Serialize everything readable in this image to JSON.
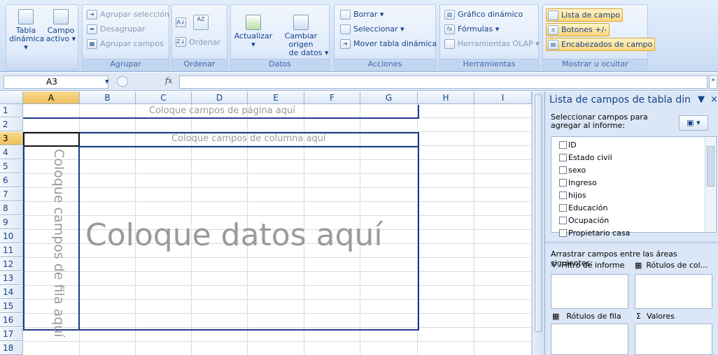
{
  "ribbon": {
    "groups": {
      "tabla_dinamica": {
        "btn_tabla": "Tabla",
        "btn_tabla2": "dinámica ▾",
        "btn_campo": "Campo",
        "btn_campo2": "activo ▾"
      },
      "agrupar": {
        "caption": "Agrupar",
        "agrupar_sel": "Agrupar selección",
        "desagrupar": "Desagrupar",
        "agrupar_campos": "Agrupar campos"
      },
      "ordenar": {
        "caption": "Ordenar",
        "ordenar": "Ordenar"
      },
      "datos": {
        "caption": "Datos",
        "actualizar": "Actualizar",
        "cambiar_origen": "Cambiar origen",
        "de_datos": "de datos ▾"
      },
      "acciones": {
        "caption": "Acciones",
        "borrar": "Borrar ▾",
        "seleccionar": "Seleccionar ▾",
        "mover": "Mover tabla dinámica"
      },
      "herramientas": {
        "caption": "Herramientas",
        "grafico": "Gráfico dinámico",
        "formulas": "Fórmulas ▾",
        "olap": "Herramientas OLAP ▾"
      },
      "mostrar": {
        "caption": "Mostrar u ocultar",
        "lista": "Lista de campo",
        "botones": "Botones +/-",
        "encabezados": "Encabezados de campo"
      }
    }
  },
  "formula_bar": {
    "name_box": "A3",
    "fx": "fx",
    "value": ""
  },
  "grid": {
    "columns": [
      "A",
      "B",
      "C",
      "D",
      "E",
      "F",
      "G",
      "H",
      "I"
    ],
    "rows": [
      "1",
      "2",
      "3",
      "4",
      "5",
      "6",
      "7",
      "8",
      "9",
      "10",
      "11",
      "12",
      "13",
      "14",
      "15",
      "16",
      "17",
      "18"
    ],
    "selected_cell": "A3",
    "pivot": {
      "page_fields": "Coloque campos de página aquí",
      "column_fields": "Coloque campos de columna aquí",
      "row_fields": "Coloque campos de fila aquí",
      "data": "Coloque datos aquí"
    }
  },
  "field_list": {
    "title": "Lista de campos de tabla din",
    "choose_label": "Seleccionar campos para agregar al informe:",
    "fields": [
      "ID",
      "Estado civil",
      "sexo",
      "Ingreso",
      "hijos",
      "Educación",
      "Ocupación",
      "Propietario casa"
    ],
    "drag_label": "Arrastrar campos entre las áreas siguientes:",
    "areas": {
      "filter": "Filtro de informe",
      "columns": "Rótulos de col...",
      "rows": "Rótulos de fila",
      "values": "Valores"
    }
  }
}
